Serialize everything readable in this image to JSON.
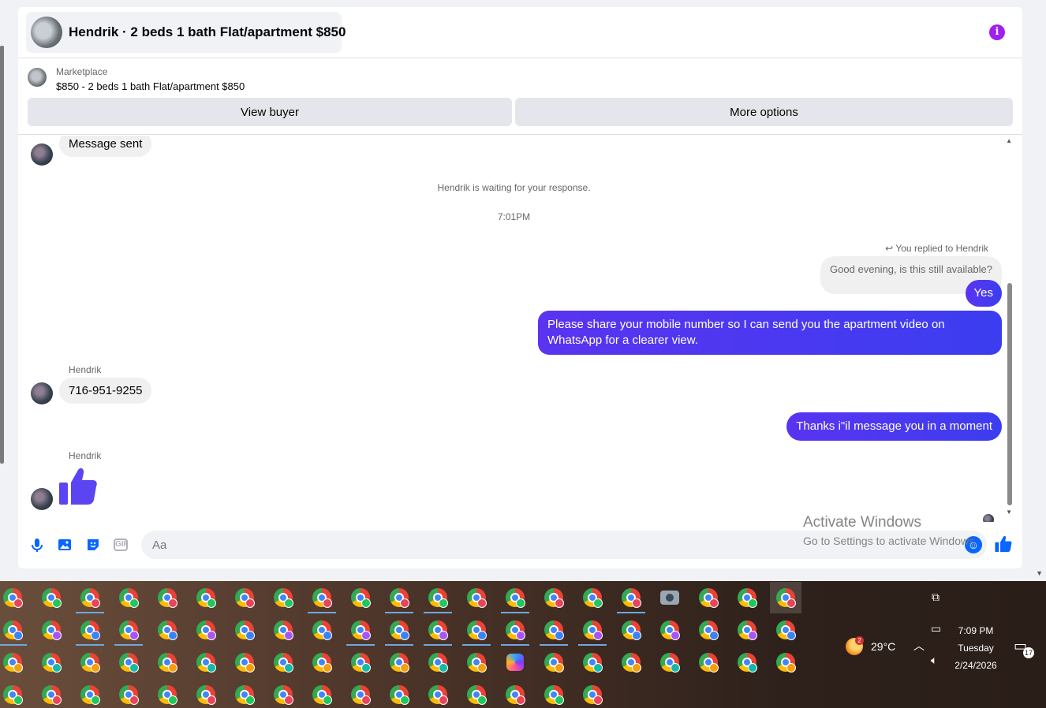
{
  "header": {
    "title": "Hendrik · 2 beds 1 bath Flat/apartment $850",
    "info_icon": "info-icon",
    "info_glyph": "i"
  },
  "listing": {
    "label": "Marketplace",
    "title": "$850 - 2 beds 1 bath Flat/apartment $850",
    "buttons": {
      "view_buyer": "View buyer",
      "more_options": "More options"
    }
  },
  "messages": {
    "first_incoming": "Message sent",
    "waiting_notice": "Hendrik is waiting for your response.",
    "timestamp": "7:01PM",
    "reply_label": "You replied to Hendrik",
    "quoted_text": "Good evening, is this still available?",
    "outgoing_1": "Yes",
    "outgoing_2": "Please share your mobile number so I can send you the apartment video on WhatsApp for a clearer view.",
    "sender_name": "Hendrik",
    "incoming_phone": "716-951-9255",
    "outgoing_3": "Thanks i\"il message you in a moment",
    "sender_name_2": "Hendrik",
    "thumbs_up_icon": "thumbs-up-icon"
  },
  "composer": {
    "placeholder": "Aa",
    "gif_label": "GIF",
    "icons": [
      "microphone-icon",
      "image-icon",
      "sticker-icon",
      "gif-icon",
      "emoji-icon",
      "like-icon"
    ]
  },
  "watermark": {
    "title": "Activate Windows",
    "subtitle": "Go to Settings to activate Windows."
  },
  "taskbar": {
    "weather_temp": "29°C",
    "weather_badge": "2",
    "time": "7:09 PM",
    "day": "Tuesday",
    "date": "2/24/2026",
    "notification_count": "17",
    "app_icons": "chrome-profile-icon"
  },
  "colors": {
    "accent": "#0866ff",
    "outgoing_bubble": "#4a38f0",
    "info_purple": "#a020f0",
    "thumbs_up": "#5b45f2"
  }
}
